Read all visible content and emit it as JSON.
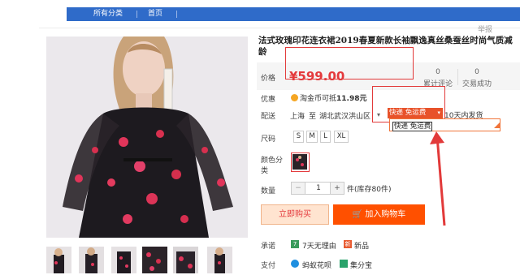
{
  "nav": {
    "items": [
      "所有分类",
      "首页"
    ]
  },
  "report_label": "举报",
  "product": {
    "title": "法式玫瑰印花连衣裙2019春夏新款长袖飘逸真丝桑蚕丝时尚气质减龄",
    "price_label": "价格",
    "price": "¥599.00",
    "review_count": "0",
    "review_label": "累计评论",
    "sales_count": "0",
    "sales_label": "交易成功"
  },
  "promo": {
    "label": "优惠",
    "text_prefix": "淘金币可抵",
    "amount": "11.98元"
  },
  "shipping": {
    "label": "配送",
    "from": "上海",
    "to_word": "至",
    "destination": "湖北武汉洪山区",
    "selected_method": "快递 免运费",
    "days": "10天内发货",
    "dropdown_options": [
      "快递 免运费"
    ]
  },
  "size": {
    "label": "尺码",
    "options": [
      "S",
      "M",
      "L",
      "XL"
    ]
  },
  "color": {
    "label": "颜色分类"
  },
  "quantity": {
    "label": "数量",
    "minus": "−",
    "value": "1",
    "plus": "+",
    "stock": "件(库存80件)"
  },
  "buttons": {
    "buy_now": "立即购买",
    "add_to_cart": "加入购物车"
  },
  "promise": {
    "label": "承诺",
    "return_policy": "7天无理由",
    "new_item": "新品"
  },
  "payment": {
    "label": "支付",
    "huabei": "蚂蚁花呗",
    "jifenbao": "集分宝"
  },
  "colors": {
    "nav": "#2f6bc9",
    "price": "#e4393c",
    "cart": "#ff5000",
    "annotation": "#e23a3a"
  }
}
